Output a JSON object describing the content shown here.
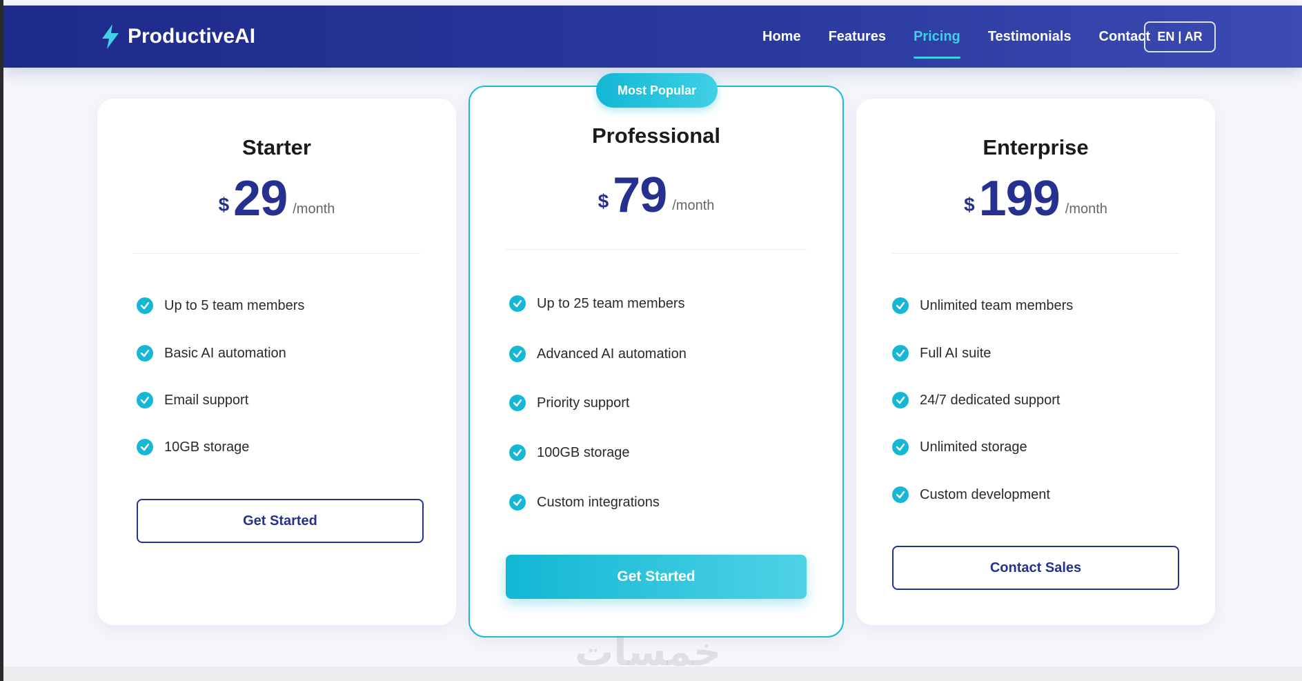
{
  "brand": {
    "name": "ProductiveAI",
    "icon": "lightning-bolt-icon"
  },
  "nav": {
    "links": [
      {
        "label": "Home",
        "active": false
      },
      {
        "label": "Features",
        "active": false
      },
      {
        "label": "Pricing",
        "active": true
      },
      {
        "label": "Testimonials",
        "active": false
      },
      {
        "label": "Contact",
        "active": false
      }
    ],
    "language_button": "EN | AR"
  },
  "plans": [
    {
      "name": "Starter",
      "currency": "$",
      "price": "29",
      "period": "/month",
      "features": [
        "Up to 5 team members",
        "Basic AI automation",
        "Email support",
        "10GB storage"
      ],
      "cta": "Get Started"
    },
    {
      "name": "Professional",
      "badge": "Most Popular",
      "currency": "$",
      "price": "79",
      "period": "/month",
      "features": [
        "Up to 25 team members",
        "Advanced AI automation",
        "Priority support",
        "100GB storage",
        "Custom integrations"
      ],
      "cta": "Get Started"
    },
    {
      "name": "Enterprise",
      "currency": "$",
      "price": "199",
      "period": "/month",
      "features": [
        "Unlimited team members",
        "Full AI suite",
        "24/7 dedicated support",
        "Unlimited storage",
        "Custom development"
      ],
      "cta": "Contact Sales"
    }
  ],
  "watermark": "خمسات",
  "colors": {
    "primary": "#25308f",
    "accent": "#14b8d4",
    "nav_bg": "#1e2a8a"
  }
}
